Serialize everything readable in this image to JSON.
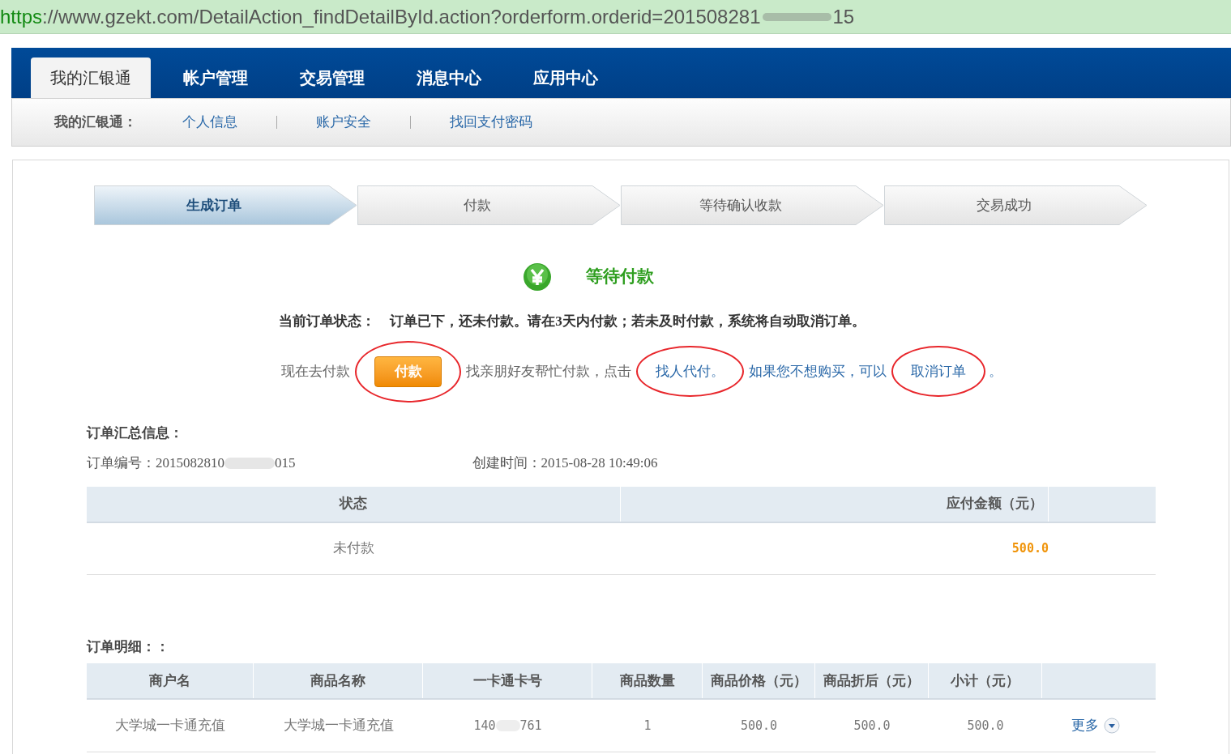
{
  "address_bar": {
    "scheme": "https",
    "rest_visible": "://www.gzekt.com/DetailAction_findDetailById.action?orderform.orderid=201508281",
    "tail_visible": "15"
  },
  "nav": {
    "tabs": [
      {
        "label": "我的汇银通",
        "selected": true
      },
      {
        "label": "帐户管理",
        "selected": false
      },
      {
        "label": "交易管理",
        "selected": false
      },
      {
        "label": "消息中心",
        "selected": false
      },
      {
        "label": "应用中心",
        "selected": false
      }
    ],
    "sub_label": "我的汇银通：",
    "sub_links": [
      "个人信息",
      "账户安全",
      "找回支付密码"
    ]
  },
  "steps": [
    {
      "label": "生成订单",
      "selected": true
    },
    {
      "label": "付款",
      "selected": false
    },
    {
      "label": "等待确认收款",
      "selected": false
    },
    {
      "label": "交易成功",
      "selected": false
    }
  ],
  "status_title": "等待付款",
  "status_line": {
    "label": "当前订单状态：",
    "text": "订单已下，还未付款。请在3天内付款；若未及时付款，系统将自动取消订单。"
  },
  "actions": {
    "pay_prompt": "现在去付款",
    "pay_button": "付款",
    "friend_prompt": "找亲朋好友帮忙付款，点击",
    "friend_link": "找人代付。",
    "cancel_prompt": "如果您不想购买，可以",
    "cancel_link": "取消订单",
    "end": "。"
  },
  "summary": {
    "title": "订单汇总信息：",
    "order_no_visible": "订单编号：2015082810",
    "order_no_tail": "015",
    "created": "创建时间：2015-08-28 10:49:06",
    "columns": [
      "状态",
      "应付金额（元）"
    ],
    "rows": [
      {
        "status": "未付款",
        "amount": "500.0"
      }
    ]
  },
  "detail": {
    "title": "订单明细：：",
    "columns": [
      "商户名",
      "商品名称",
      "一卡通卡号",
      "商品数量",
      "商品价格（元）",
      "商品折后（元）",
      "小计（元）"
    ],
    "rows": [
      {
        "merchant": "大学城一卡通充值",
        "product": "大学城一卡通充值",
        "card_visible": "140",
        "card_tail": "761",
        "quantity": "1",
        "price": "500.0",
        "discounted": "500.0",
        "subtotal": "500.0",
        "more": "更多"
      }
    ]
  }
}
